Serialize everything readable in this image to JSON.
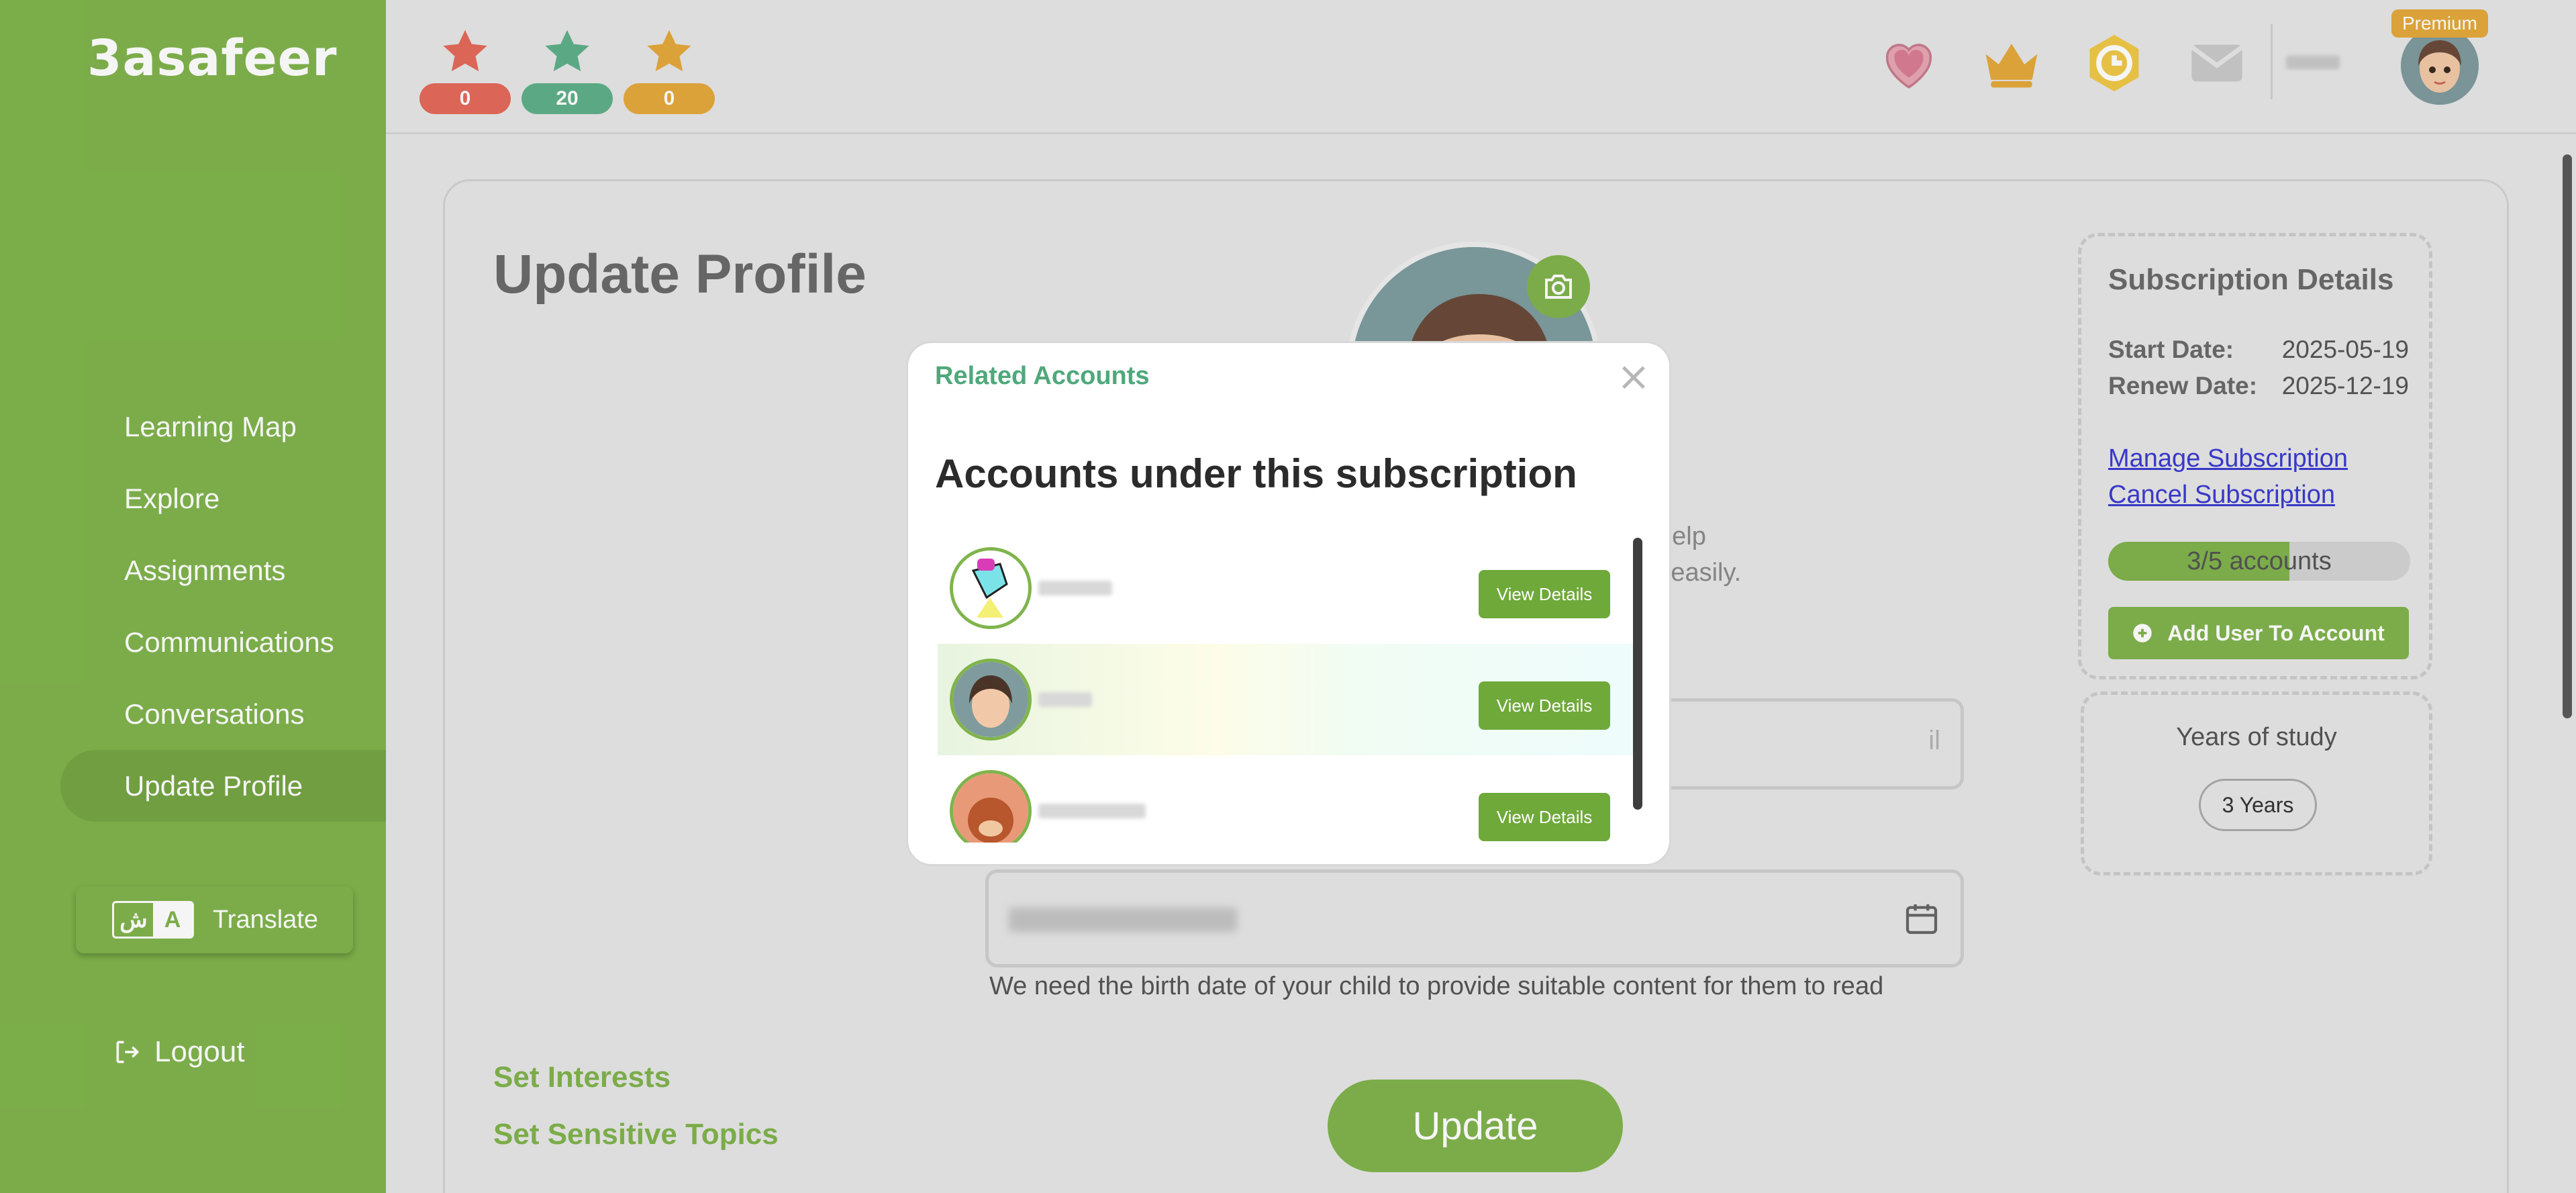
{
  "app": {
    "logo": "3asafeer"
  },
  "sidebar": {
    "items": [
      {
        "label": "Learning Map"
      },
      {
        "label": "Explore"
      },
      {
        "label": "Assignments"
      },
      {
        "label": "Communications"
      },
      {
        "label": "Conversations"
      },
      {
        "label": "Update Profile",
        "active": true
      }
    ],
    "translate": {
      "glyph_a": "ش",
      "glyph_b": "A",
      "label": "Translate"
    },
    "logout": "Logout"
  },
  "topbar": {
    "stars": [
      {
        "count": "0",
        "color": "#e46a5a"
      },
      {
        "count": "20",
        "color": "#5fb08a"
      },
      {
        "count": "0",
        "color": "#e4a93c"
      }
    ],
    "icons": [
      "heart-icon",
      "crown-icon",
      "coin-icon",
      "mail-icon"
    ],
    "premium_badge": "Premium"
  },
  "profile": {
    "title": "Update Profile",
    "help_line_1": "help",
    "help_line_2": "er easily.",
    "email_placeholder": "il",
    "birth_note": "We need the birth date of your child to provide suitable content for them to read",
    "set_interests": "Set Interests",
    "set_sensitive_topics": "Set Sensitive Topics",
    "update_button": "Update"
  },
  "subscription": {
    "title": "Subscription Details",
    "start_label": "Start Date:",
    "start_value": "2025-05-19",
    "renew_label": "Renew Date:",
    "renew_value": "2025-12-19",
    "manage_link": "Manage Subscription",
    "cancel_link": "Cancel Subscription",
    "accounts_used": 3,
    "accounts_total": 5,
    "accounts_label": "3/5 accounts",
    "add_user_button": "Add User To Account"
  },
  "years": {
    "title": "Years of study",
    "value": "3 Years"
  },
  "modal": {
    "kicker": "Related Accounts",
    "close": "×",
    "title": "Accounts under this subscription",
    "accounts": [
      {
        "view_label": "View Details"
      },
      {
        "view_label": "View Details"
      },
      {
        "view_label": "View Details"
      }
    ]
  },
  "colors": {
    "brand_green": "#80b44c",
    "link_blue": "#3b3bd1",
    "accent_teal": "#4fa87b"
  }
}
